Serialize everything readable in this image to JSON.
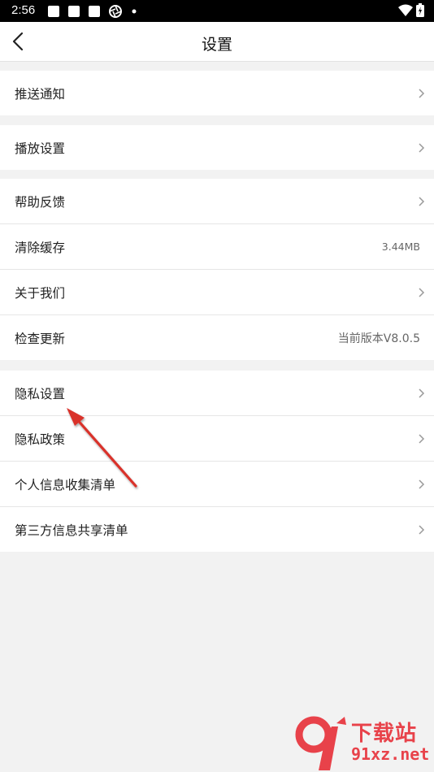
{
  "status_bar": {
    "time": "2:56"
  },
  "header": {
    "title": "设置"
  },
  "groups": [
    {
      "items": [
        {
          "label": "推送通知"
        }
      ]
    },
    {
      "items": [
        {
          "label": "播放设置"
        }
      ]
    },
    {
      "items": [
        {
          "label": "帮助反馈"
        },
        {
          "label": "清除缓存",
          "value": "3.44MB"
        },
        {
          "label": "关于我们"
        },
        {
          "label": "检查更新",
          "value": "当前版本V8.0.5"
        }
      ]
    },
    {
      "items": [
        {
          "label": "隐私设置"
        },
        {
          "label": "隐私政策"
        },
        {
          "label": "个人信息收集清单"
        },
        {
          "label": "第三方信息共享清单"
        }
      ]
    }
  ],
  "annotation": {
    "color": "#d9302c"
  },
  "watermark": {
    "title": "下载站",
    "url": "91xz.net",
    "color": "#e8424a"
  }
}
